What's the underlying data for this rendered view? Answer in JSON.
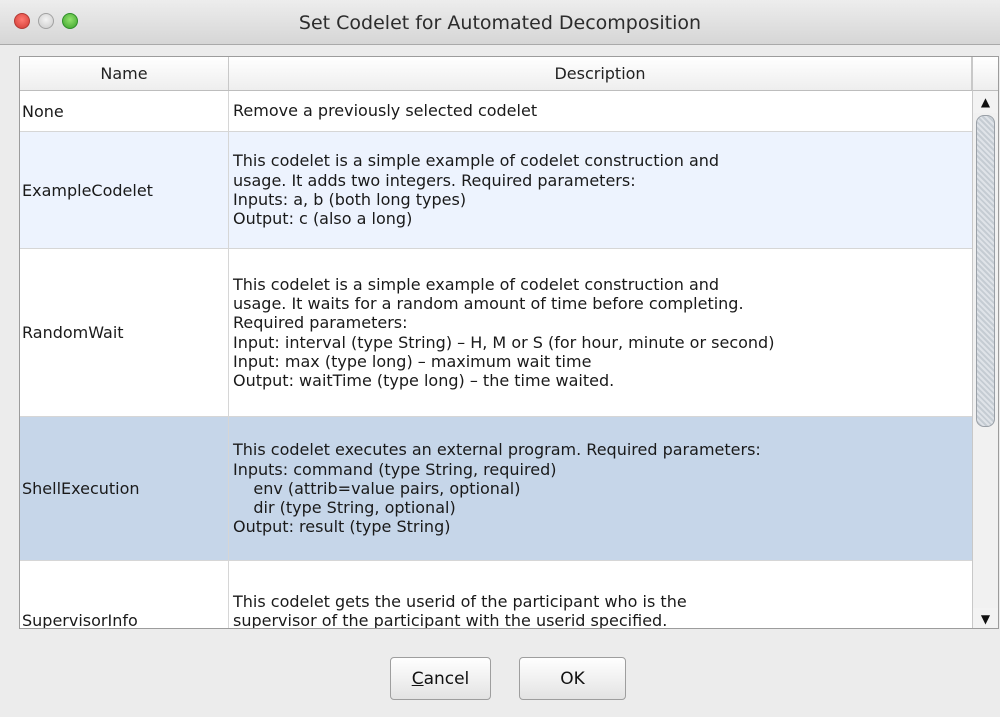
{
  "window": {
    "title": "Set Codelet for Automated Decomposition"
  },
  "table": {
    "columns": [
      "Name",
      "Description"
    ],
    "rows": [
      {
        "name": "None",
        "description": "Remove a previously selected codelet"
      },
      {
        "name": "ExampleCodelet",
        "description": "This codelet is a simple example of codelet construction and\nusage. It adds two integers. Required parameters:\nInputs: a, b (both long types)\nOutput: c (also a long)"
      },
      {
        "name": "RandomWait",
        "description": "This codelet is a simple example of codelet construction and\nusage. It waits for a random amount of time before completing.\nRequired parameters:\nInput: interval (type String) – H, M or S (for hour, minute or second)\nInput: max (type long) – maximum wait time\nOutput: waitTime (type long) – the time waited."
      },
      {
        "name": "ShellExecution",
        "description": "This codelet executes an external program. Required parameters:\nInputs: command (type String, required)\n    env (attrib=value pairs, optional)\n    dir (type String, optional)\nOutput: result (type String)"
      },
      {
        "name": "SupervisorInfo",
        "description": "This codelet gets the userid of the participant who is the\nsupervisor of the participant with the userid specified.\nInput: userid (string type)"
      }
    ]
  },
  "buttons": {
    "cancel_rest": "ancel",
    "cancel_mnemonic": "C",
    "ok": "OK"
  },
  "icons": {
    "scroll_up": "▲",
    "scroll_down": "▼"
  },
  "colors": {
    "selected_row": "#c6d6e9",
    "striped_row": "#edf3fe"
  }
}
